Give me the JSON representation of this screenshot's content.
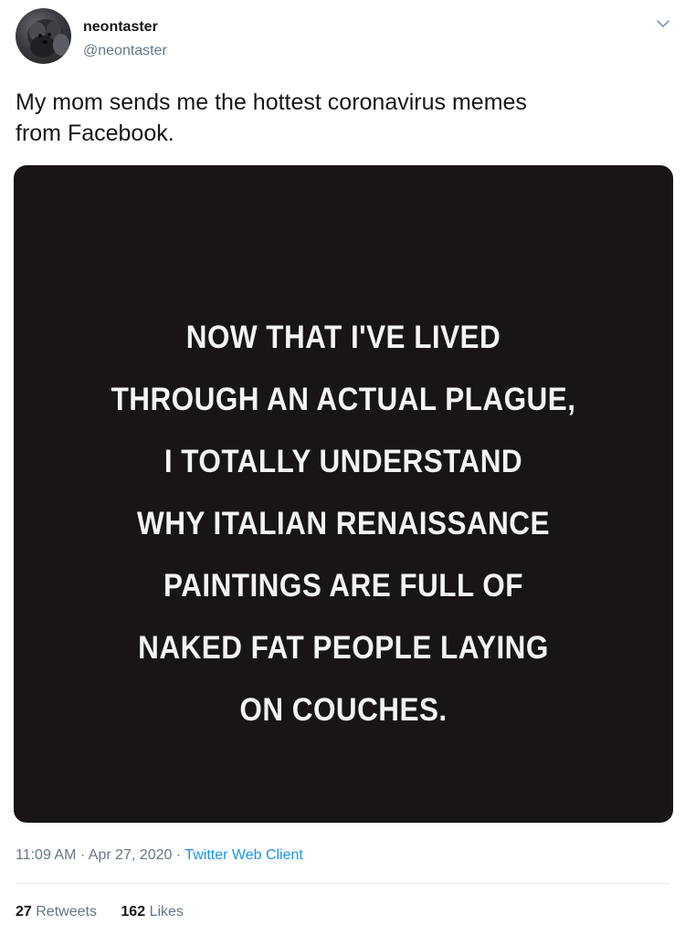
{
  "user": {
    "display_name": "neontaster",
    "handle": "@neontaster",
    "avatar_icon": "dog-avatar"
  },
  "tweet": {
    "text_lines": [
      "My mom sends me the hottest coronavirus memes",
      "from Facebook."
    ],
    "media": {
      "background_color": "#191415",
      "text_lines": [
        "NOW THAT I'VE LIVED",
        "THROUGH AN ACTUAL PLAGUE,",
        "I TOTALLY UNDERSTAND",
        "WHY ITALIAN RENAISSANCE",
        "PAINTINGS ARE FULL OF",
        "NAKED FAT PEOPLE LAYING",
        "ON COUCHES."
      ]
    },
    "time": "11:09 AM",
    "separator": "·",
    "date": "Apr 27, 2020",
    "source": "Twitter Web Client"
  },
  "stats": {
    "retweets_count": "27",
    "retweets_label": "Retweets",
    "likes_count": "162",
    "likes_label": "Likes"
  },
  "colors": {
    "link": "#1b95e0",
    "secondary_text": "#657786",
    "primary_text": "#14171a"
  }
}
